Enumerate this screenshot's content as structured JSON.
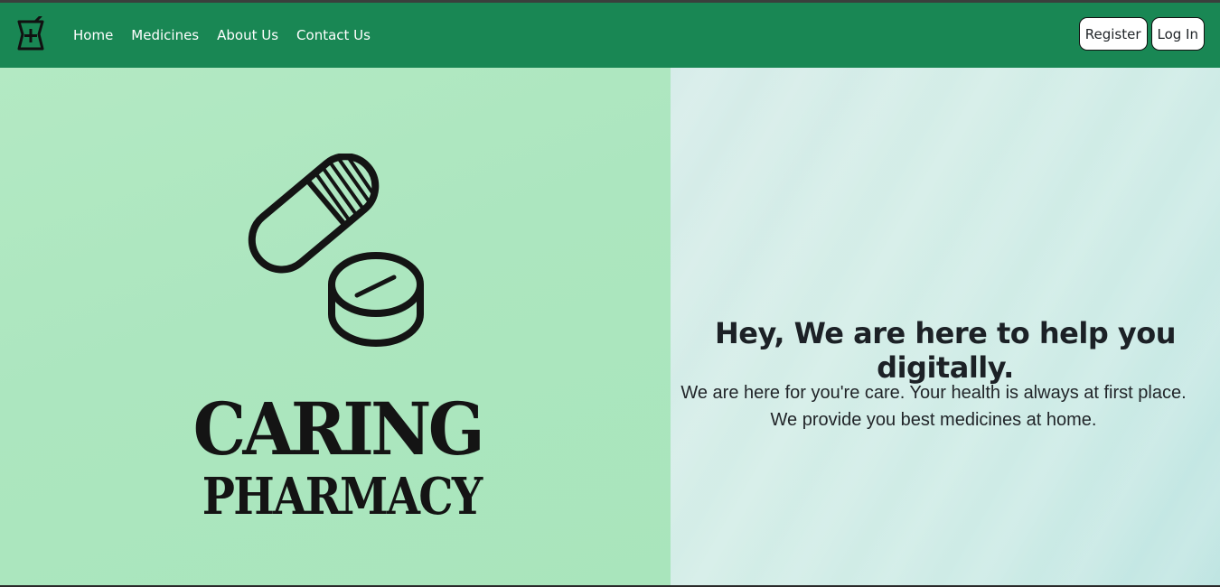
{
  "navbar": {
    "brand_icon": "mortar-pestle-plus-icon",
    "links": [
      {
        "label": "Home"
      },
      {
        "label": "Medicines"
      },
      {
        "label": "About Us"
      },
      {
        "label": "Contact Us"
      }
    ],
    "register_label": "Register",
    "login_label": "Log In",
    "color": "#198754"
  },
  "hero_left": {
    "logo_icon": "pills-icon",
    "logo_line1": "CARING",
    "logo_line2": "PHARMACY",
    "background": "#ace6bf"
  },
  "hero_right": {
    "title": "Hey, We are here to help you digitally.",
    "line1": "We are here for you're care. Your health is always at first place.",
    "line2": "We provide you best medicines at home.",
    "background": "#d3ede7"
  }
}
